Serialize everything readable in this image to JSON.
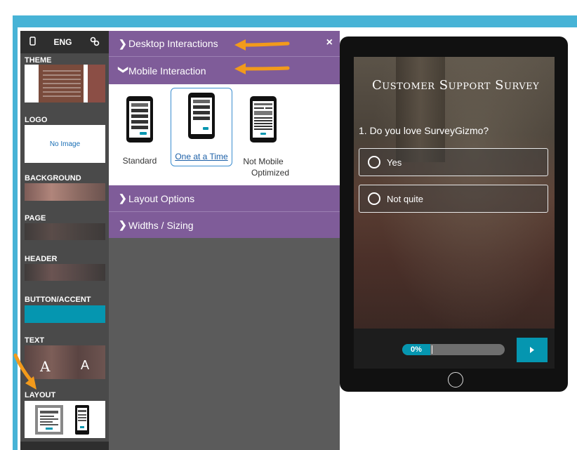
{
  "sidebar": {
    "top_icons": [
      "phone-icon",
      "ENG",
      "link-icon"
    ],
    "lang": "ENG",
    "sections": {
      "theme": "THEME",
      "logo": "LOGO",
      "logo_placeholder": "No Image",
      "background": "BACKGROUND",
      "page": "PAGE",
      "header": "HEADER",
      "button_accent": "BUTTON/ACCENT",
      "text": "TEXT",
      "text_sample_a1": "A",
      "text_sample_a2": "A",
      "layout": "LAYOUT"
    }
  },
  "panel": {
    "desktop_interactions": "Desktop Interactions",
    "mobile_interaction": "Mobile Interaction",
    "layout_options": "Layout Options",
    "widths_sizing": "Widths / Sizing",
    "close": "×",
    "mobile_options": [
      {
        "label": "Standard",
        "selected": false
      },
      {
        "label": "One at a Time",
        "selected": true
      },
      {
        "label": "Not Mobile Optimized",
        "line1": "Not Mobile",
        "line2": "Optimized",
        "selected": false
      }
    ]
  },
  "preview": {
    "survey_title": "Customer Support Survey",
    "question": "1. Do you love SurveyGizmo?",
    "answers": [
      "Yes",
      "Not quite"
    ],
    "progress_text": "0%",
    "progress": 0,
    "next_icon": "play-icon"
  },
  "colors": {
    "accent": "#0596b0",
    "panel_purple": "#7f5c99",
    "frame_blue": "#47b3d6",
    "arrow_orange": "#f29a1b"
  }
}
